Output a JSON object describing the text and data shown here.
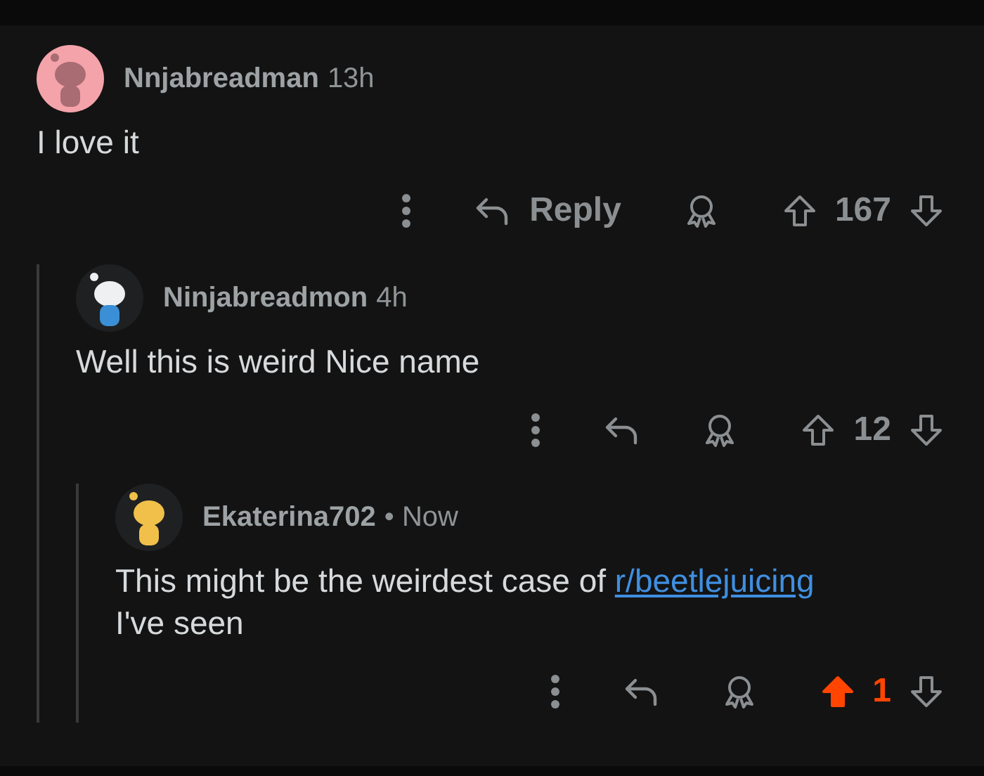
{
  "comments": [
    {
      "author": "Nnjabreadman",
      "time": "13h",
      "body": [
        {
          "kind": "text",
          "text": "I love it"
        }
      ],
      "reply_label": "Reply",
      "score": "167",
      "upvoted": false,
      "children": [
        {
          "author": "Ninjabreadmon",
          "time": "4h",
          "body": [
            {
              "kind": "text",
              "text": "Well this is weird Nice name"
            }
          ],
          "score": "12",
          "upvoted": false,
          "children": [
            {
              "author": "Ekaterina702",
              "time": "• Now",
              "body": [
                {
                  "kind": "text",
                  "text": "This might be the weirdest case of "
                },
                {
                  "kind": "link",
                  "text": "r/beetlejuicing"
                },
                {
                  "kind": "text",
                  "text": " I've seen"
                }
              ],
              "score": "1",
              "upvoted": true
            }
          ]
        }
      ]
    }
  ]
}
